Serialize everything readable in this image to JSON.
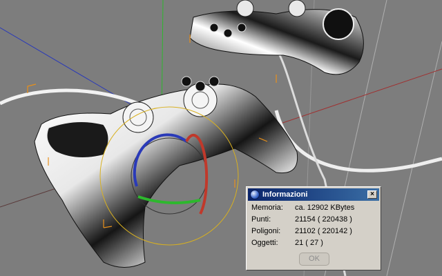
{
  "viewport": {
    "scene": "3d-gamepad-render"
  },
  "dialog": {
    "title": "Informazioni",
    "title_icon": "info-globe-icon",
    "close_label": "×",
    "rows": [
      {
        "label": "Memoria:",
        "value": "ca. 12902 KBytes"
      },
      {
        "label": "Punti:",
        "value": "21154 ( 220438 )"
      },
      {
        "label": "Poligoni:",
        "value": "21102 ( 220142 )"
      },
      {
        "label": "Oggetti:",
        "value": "21 ( 27 )"
      }
    ],
    "ok_label": "OK"
  },
  "colors": {
    "background": "#7d7d7d",
    "axis_y": "#2db82d",
    "axis_x": "#c0392b",
    "axis_z": "#2a3ab8",
    "bbox": "#e8901a",
    "titlebar": "#0a246a"
  }
}
